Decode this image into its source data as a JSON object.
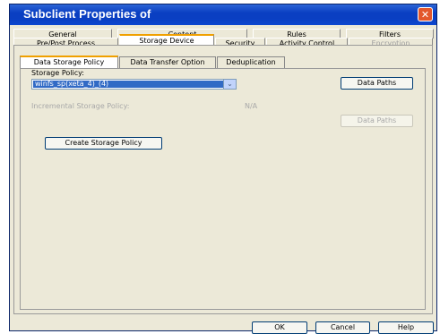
{
  "window": {
    "title": "Subclient Properties of",
    "close_icon": "close-icon"
  },
  "tabs_row1": [
    {
      "label": "General"
    },
    {
      "label": "Content"
    },
    {
      "label": "Rules"
    },
    {
      "label": "Filters"
    }
  ],
  "tabs_row2": [
    {
      "label": "Pre/Post Process"
    },
    {
      "label": "Storage Device",
      "active": true
    },
    {
      "label": "Security"
    },
    {
      "label": "Activity Control"
    },
    {
      "label": "Encryption",
      "disabled": true
    }
  ],
  "inner_tabs": [
    {
      "label": "Data Storage Policy",
      "active": true
    },
    {
      "label": "Data Transfer Option"
    },
    {
      "label": "Deduplication"
    }
  ],
  "storage_policy": {
    "label": "Storage Policy:",
    "value": "winfs_sp(xeta_4)_(4)",
    "data_paths_button": "Data Paths"
  },
  "incremental": {
    "label": "Incremental Storage Policy:",
    "value": "N/A",
    "data_paths_button": "Data Paths"
  },
  "create_button": "Create Storage Policy",
  "footer": {
    "ok": "OK",
    "cancel": "Cancel",
    "help": "Help"
  },
  "colors": {
    "title_bar": "#0a3fc2",
    "selection": "#316ac5",
    "active_tab_accent": "#f0a000"
  }
}
